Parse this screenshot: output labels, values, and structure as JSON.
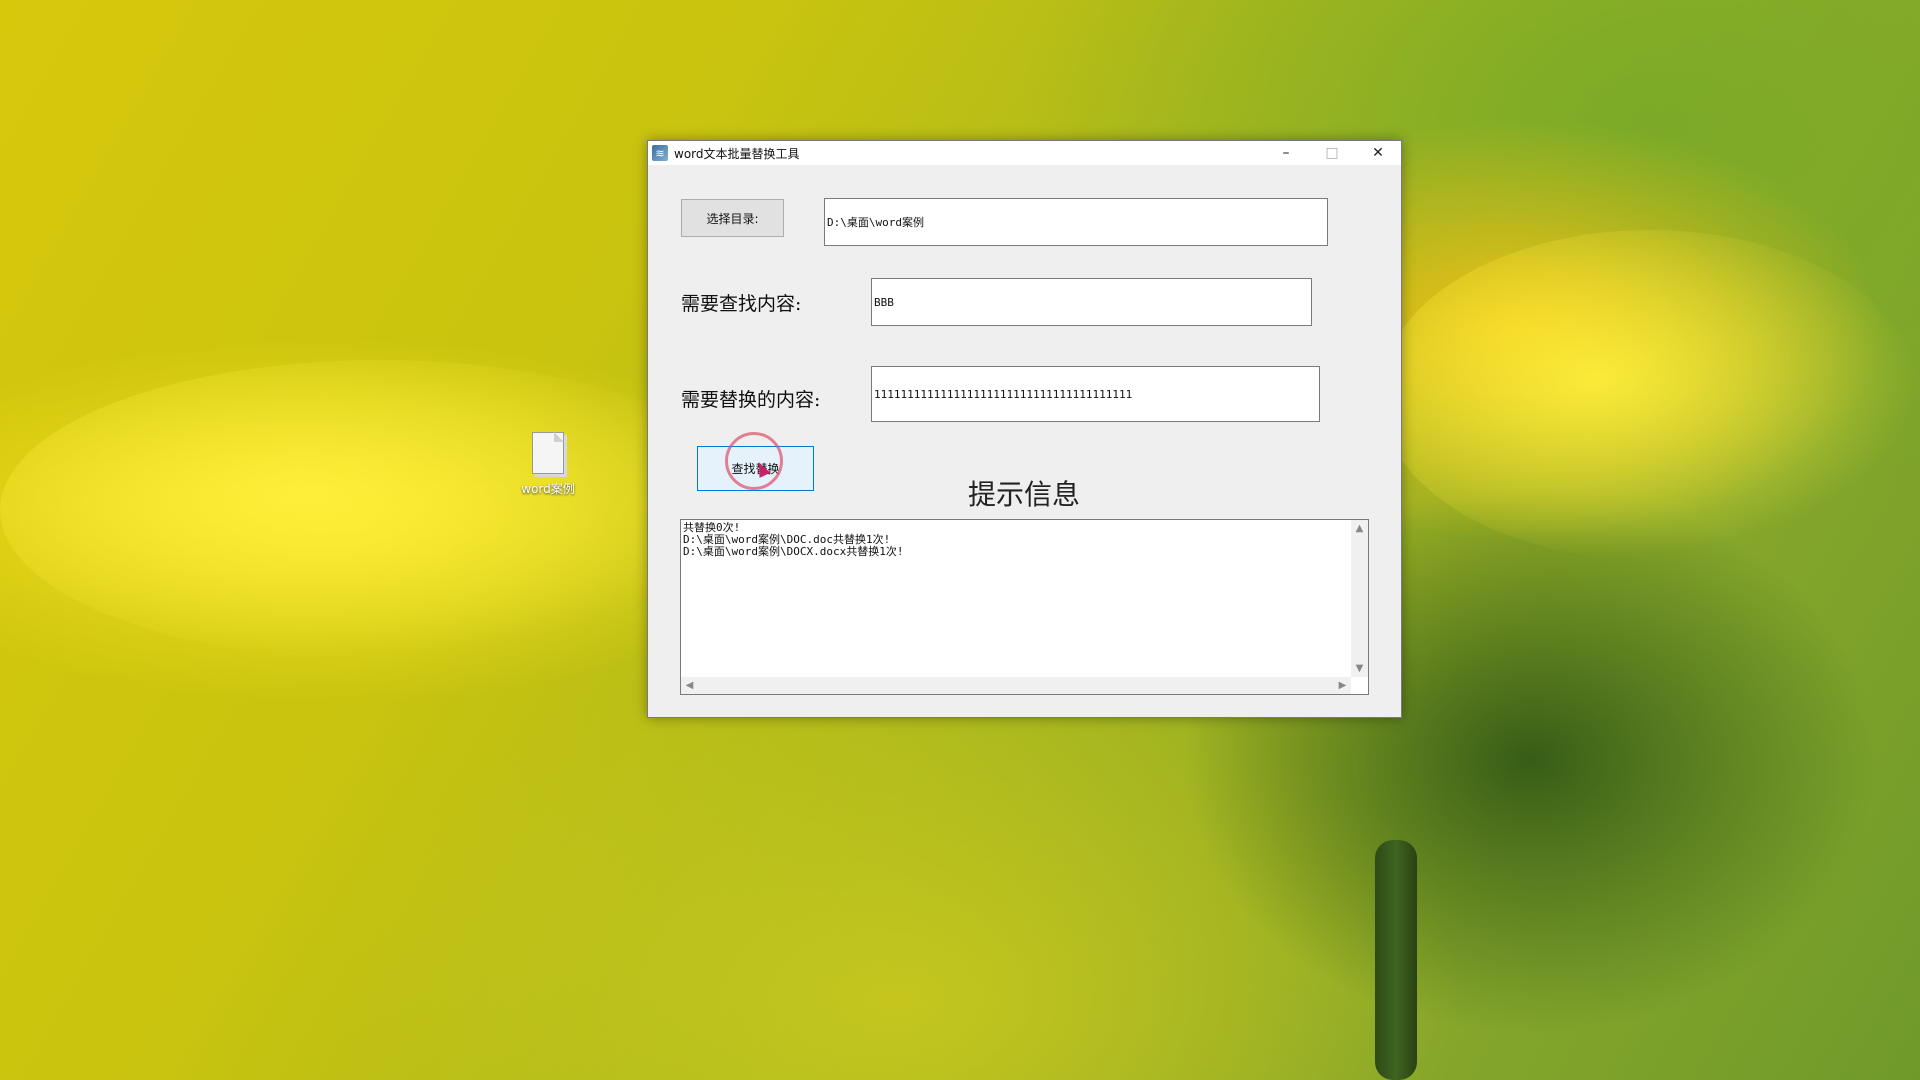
{
  "desktop": {
    "icon_label": "word案例"
  },
  "window": {
    "title": "word文本批量替换工具",
    "controls": {
      "minimize": "–",
      "maximize": "□",
      "close": "✕"
    }
  },
  "form": {
    "select_dir_label": "选择目录:",
    "dir_value": "D:\\桌面\\word案例",
    "find_label": "需要查找内容:",
    "find_value": "BBB",
    "replace_label": "需要替换的内容:",
    "replace_value": "111111111111111111111111111111111111111",
    "action_label": "查找替换"
  },
  "hint": {
    "title": "提示信息",
    "lines": [
      "共替换0次!",
      "D:\\桌面\\word案例\\DOC.doc共替换1次!",
      "D:\\桌面\\word案例\\DOCX.docx共替换1次!"
    ]
  }
}
